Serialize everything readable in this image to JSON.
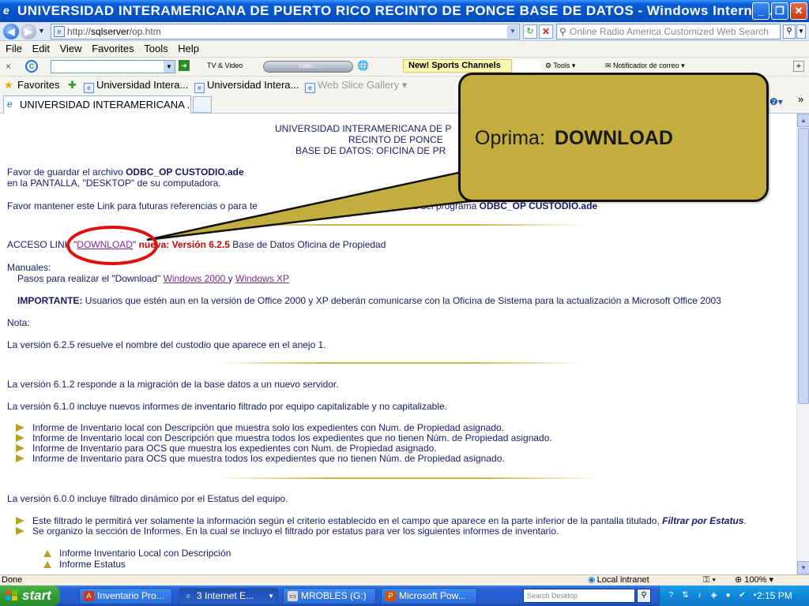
{
  "window": {
    "title": "UNIVERSIDAD INTERAMERICANA DE PUERTO RICO RECINTO DE PONCE BASE DE DATOS - Windows Internet ...",
    "minimize": "_",
    "restore": "❐",
    "close": "✕"
  },
  "address": {
    "url_prefix": "http://",
    "url_host": "sqlserver",
    "url_path": "/op.htm",
    "search_placeholder": "Online Radio America Customized Web Search"
  },
  "menu": [
    "File",
    "Edit",
    "View",
    "Favorites",
    "Tools",
    "Help"
  ],
  "toolbar": {
    "tv_label": "TV & Video",
    "player_label": "Calito...",
    "news_label": "New! Sports Channels",
    "tools_label": "Tools",
    "mail_label": "Notificador de correo"
  },
  "favorites": {
    "label": "Favorites",
    "links": [
      "Universidad Intera...",
      "Universidad Intera...",
      "Web Slice Gallery"
    ]
  },
  "tab": {
    "title": "UNIVERSIDAD INTERAMERICANA ..."
  },
  "page": {
    "header_lines": [
      "UNIVERSIDAD INTERAMERICANA DE P",
      "RECINTO DE PONCE",
      "BASE DE DATOS: OFICINA DE PR"
    ],
    "save_prefix": "Favor de guardar el archivo ",
    "save_file": "ODBC_OP CUSTODIO.ade",
    "save_line2": "en la PANTALLA,  \"DESKTOP\" de su computadora.",
    "keep_prefix": "Favor mantener este Link para futuras referencias o para te",
    "keep_suffix": "as nuevas versiones del programa ",
    "keep_file": "ODBC_OP CUSTODIO.ade",
    "access_prefix": "ACCESO LINK \"",
    "download_link": "DOWNLOAD",
    "access_mid": "\" ",
    "new_version": "nueva: Versión 6.2.5",
    "access_suffix": " Base de Datos Oficina de Propiedad",
    "manuals_label": "Manuales:",
    "steps_prefix": "Pasos para realizar el \"Download\" ",
    "win2000_link": "Windows 2000 ",
    "y_text": "y ",
    "winxp_link": "Windows XP",
    "important_label": "IMPORTANTE:",
    "important_text": " Usuarios que estén aun en la versión de Office 2000 y XP deberán comunicarse con la Oficina de Sistema para la actualización a Microsoft Office 2003",
    "nota_label": "Nota:",
    "note_625": "La versión 6.2.5 resuelve el nombre del custodio que aparece en el anejo 1.",
    "note_612": "La versión 6.1.2  responde a la migración de la base datos a un nuevo servidor.",
    "note_610": "La versión 6.1.0 incluye nuevos informes de inventario filtrado por equipo capitalizable y no capitalizable.",
    "bullets_610": [
      "Informe de Inventario local con Descripción que muestra solo los expedientes con Num. de Propiedad asignado.",
      "Informe de Inventario local con Descripción que muestra todos los expedientes que no tienen Núm. de Propiedad asignado.",
      "Informe de Inventario para OCS que muestra los expedientes con Num. de Propiedad asignado.",
      "Informe de Inventario para OCS que muestra todos los expedientes que no tienen Núm. de Propiedad asignado."
    ],
    "note_600": "La versión 6.0.0 incluye filtrado dinámico por el Estatus del equipo.",
    "bullet_600_1_prefix": "Este filtrado le permitirá ver solamente la información según el criterio establecido en el campo que aparece en la parte inferior de la pantalla titulado, ",
    "bullet_600_1_emph": "Filtrar por Estatus",
    "bullet_600_1_suffix": ".",
    "bullet_600_2": "Se organizo la sección de Informes. En la cual se incluyo el filtrado por estatus para ver los siguientes informes de inventario.",
    "sub_items": [
      "Informe Inventario Local con Descripción",
      "Informe Estatus"
    ]
  },
  "status": {
    "text": "Done",
    "zone": "Local intranet",
    "zoom": "100%"
  },
  "taskbar": {
    "start": "start",
    "tasks": [
      "Inventario Pro...",
      "3 Internet E...",
      "MROBLES (G:)",
      "Microsoft Pow..."
    ],
    "search_placeholder": "Search Desktop",
    "clock": "2:15 PM"
  },
  "callout": {
    "prefix": "Oprima:",
    "emphasis": "DOWNLOAD"
  },
  "colors": {
    "callout_fill": "#c3ad3e",
    "highlight_ring": "#e01010",
    "link": "#7a2a8a",
    "alert_text": "#cc0000"
  }
}
